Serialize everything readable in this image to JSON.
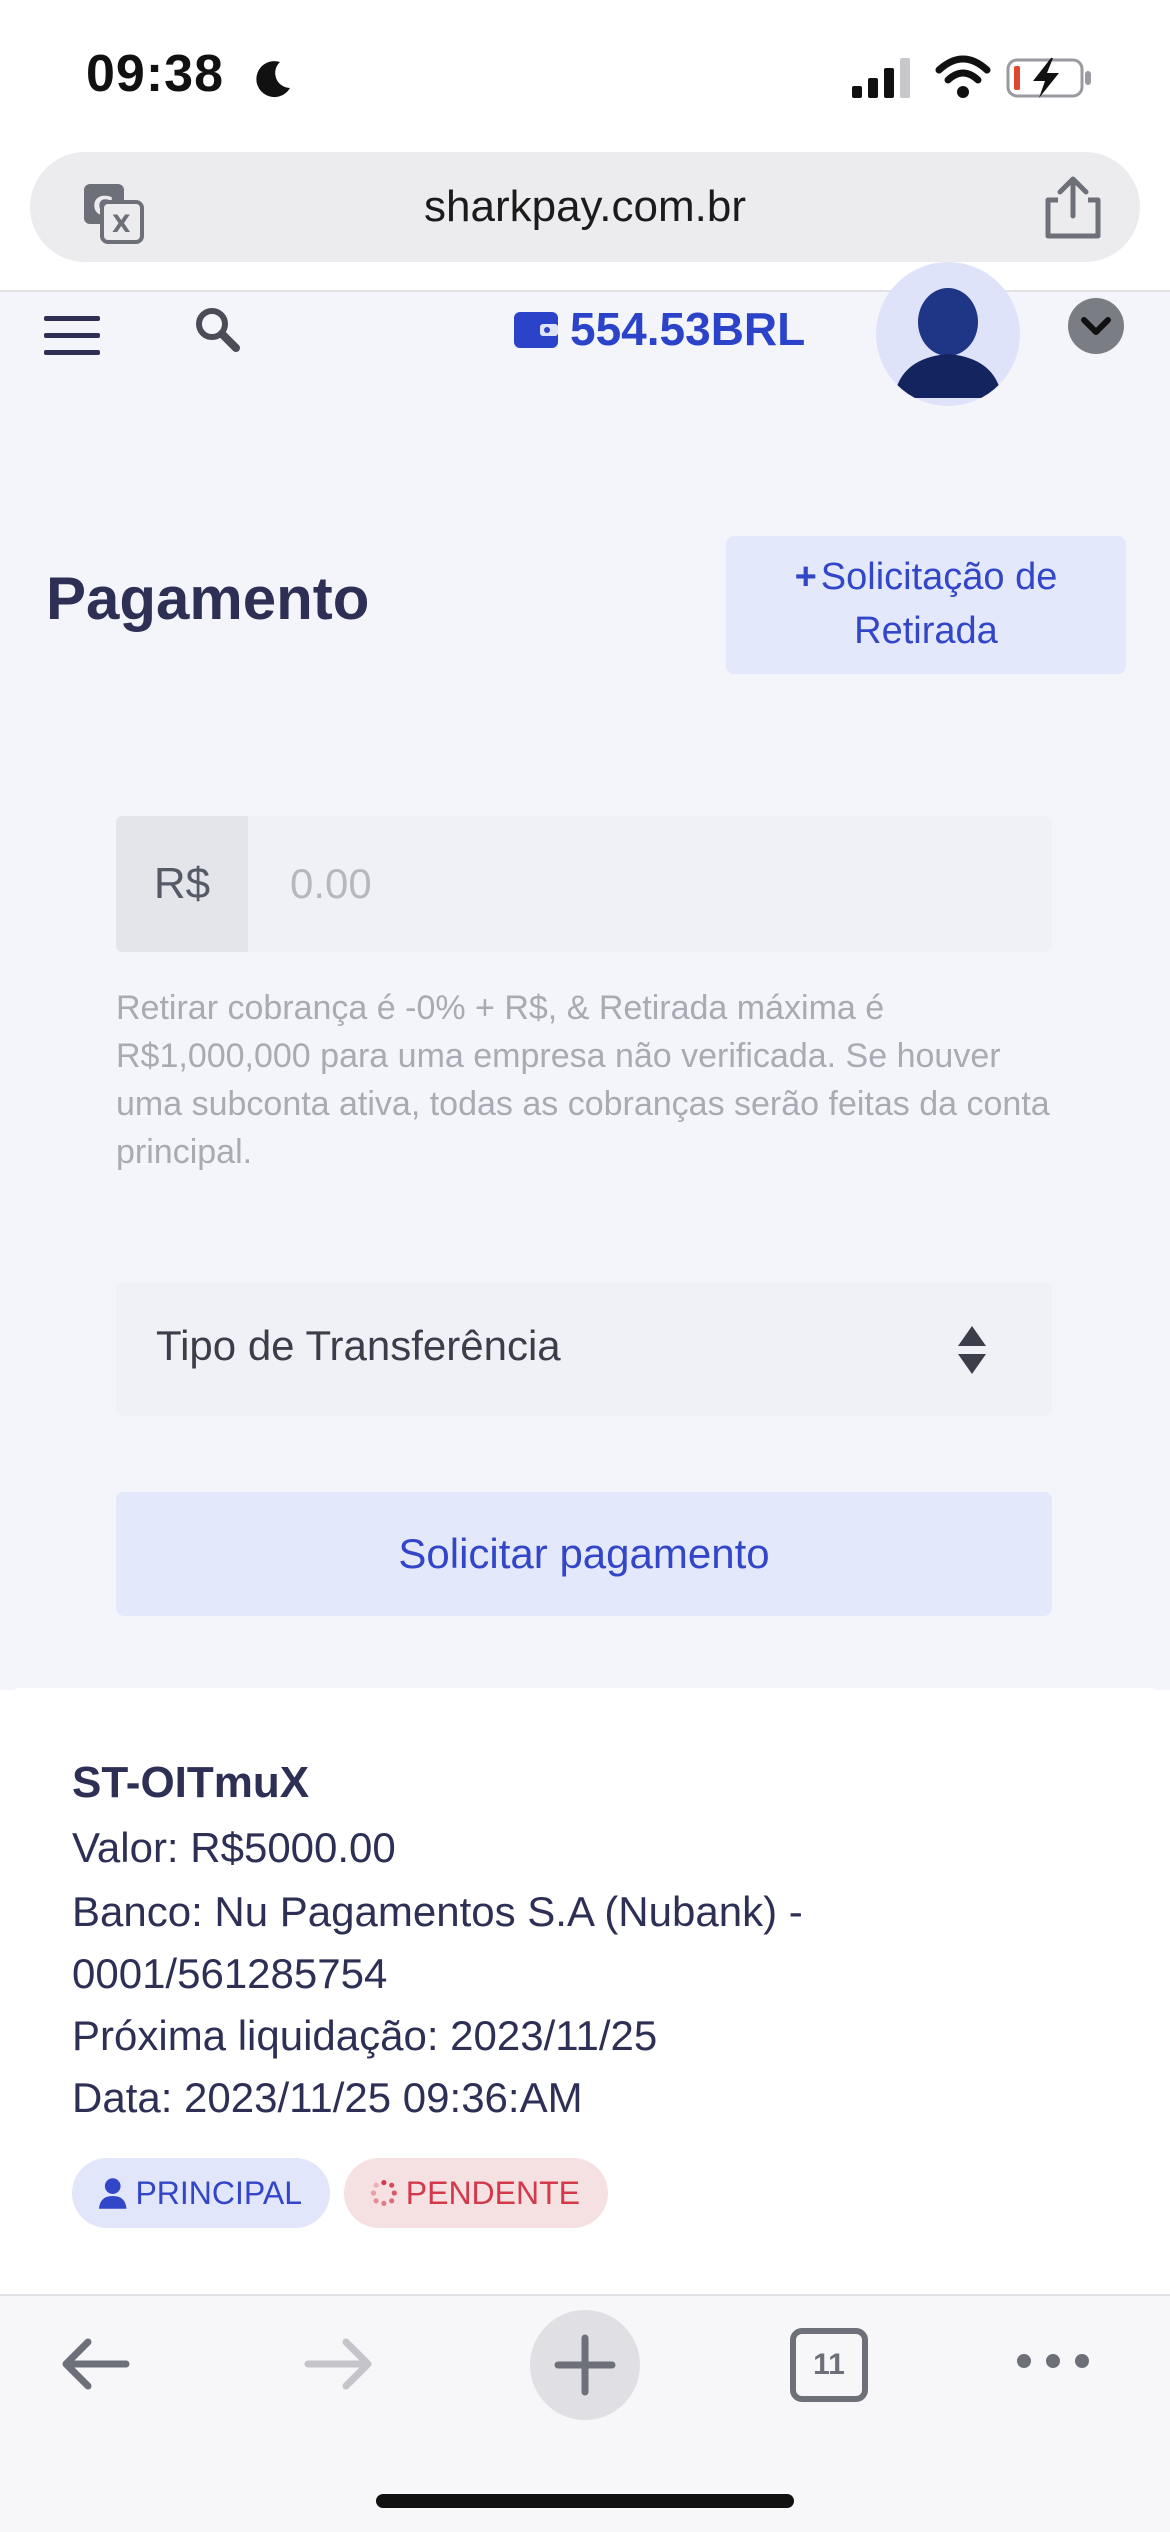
{
  "status_bar": {
    "time": "09:38",
    "icons": [
      "moon-icon",
      "signal-icon",
      "wifi-icon",
      "battery-charging-icon"
    ]
  },
  "browser": {
    "url": "sharkpay.com.br",
    "icons": [
      "translate-icon",
      "share-icon"
    ]
  },
  "header": {
    "balance": "554.53BRL",
    "icons": [
      "menu-icon",
      "search-icon",
      "wallet-icon",
      "avatar",
      "chevron-down-icon"
    ]
  },
  "page": {
    "title": "Pagamento",
    "withdraw_button_line1": "Solicitação de",
    "withdraw_button_line2": "Retirada"
  },
  "form": {
    "currency_prefix": "R$",
    "amount_placeholder": "0.00",
    "fee_note": "Retirar cobrança é -0% + R$, & Retirada máxima é R$1,000,000 para uma empresa não verificada. Se houver uma subconta ativa, todas as cobranças serão feitas da conta principal.",
    "transfer_type_label": "Tipo de Transferência",
    "submit_label": "Solicitar pagamento"
  },
  "payout": {
    "id": "ST-OITmuX",
    "amount": "Valor: R$5000.00",
    "bank_line1": "Banco: Nu Pagamentos S.A (Nubank) -",
    "bank_line2": "0001/561285754",
    "next_settlement": "Próxima liquidação: 2023/11/25",
    "date": "Data: 2023/11/25 09:36:AM",
    "badge_account": "PRINCIPAL",
    "badge_status": "PENDENTE"
  },
  "toolbar": {
    "tab_count": "11",
    "icons": [
      "back-arrow-icon",
      "forward-arrow-icon",
      "plus-icon",
      "tabs-icon",
      "more-icon"
    ]
  },
  "colors": {
    "accent": "#3346c8",
    "accent_bg": "#e3e8fb",
    "pending": "#d23a4b",
    "title": "#2d2f55",
    "content_bg": "#f4f5fb"
  }
}
